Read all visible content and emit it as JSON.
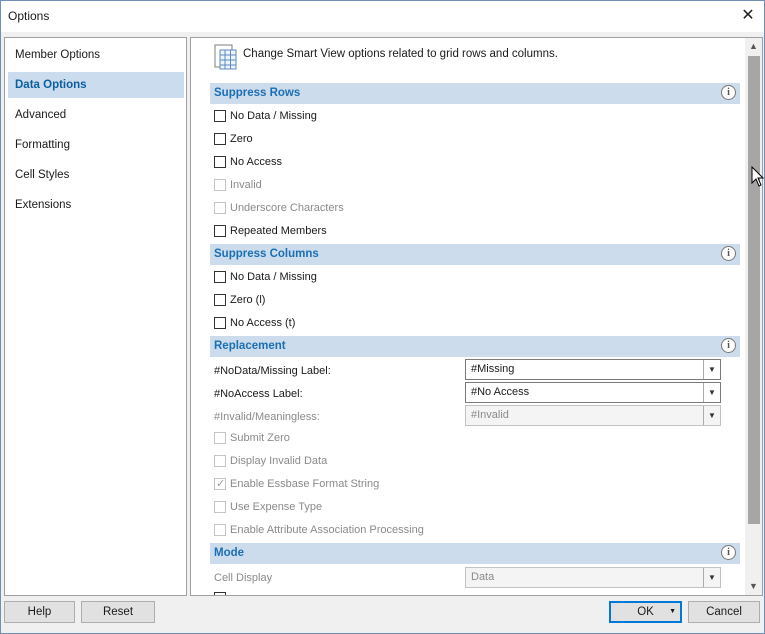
{
  "window": {
    "title": "Options"
  },
  "nav": {
    "items": [
      {
        "label": "Member Options"
      },
      {
        "label": "Data Options"
      },
      {
        "label": "Advanced"
      },
      {
        "label": "Formatting"
      },
      {
        "label": "Cell Styles"
      },
      {
        "label": "Extensions"
      }
    ],
    "selected": "Data Options"
  },
  "panel": {
    "header_text": "Change Smart View options related to grid rows and columns.",
    "suppress_rows": {
      "title": "Suppress Rows",
      "options": [
        {
          "label": "No Data / Missing",
          "checked": false,
          "enabled": true
        },
        {
          "label": "Zero",
          "checked": false,
          "enabled": true
        },
        {
          "label": "No Access",
          "checked": false,
          "enabled": true
        },
        {
          "label": "Invalid",
          "checked": false,
          "enabled": false
        },
        {
          "label": "Underscore Characters",
          "checked": false,
          "enabled": false
        },
        {
          "label": "Repeated Members",
          "checked": false,
          "enabled": true
        }
      ]
    },
    "suppress_columns": {
      "title": "Suppress Columns",
      "options": [
        {
          "label": "No Data / Missing",
          "checked": false,
          "enabled": true
        },
        {
          "label": "Zero (l)",
          "checked": false,
          "enabled": true
        },
        {
          "label": "No Access (t)",
          "checked": false,
          "enabled": true
        }
      ]
    },
    "replacement": {
      "title": "Replacement",
      "fields": [
        {
          "label": "#NoData/Missing Label:",
          "value": "#Missing",
          "enabled": true
        },
        {
          "label": "#NoAccess Label:",
          "value": "#No Access",
          "enabled": true
        },
        {
          "label": "#Invalid/Meaningless:",
          "value": "#Invalid",
          "enabled": false
        }
      ],
      "options": [
        {
          "label": "Submit Zero",
          "checked": false,
          "enabled": false
        },
        {
          "label": "Display Invalid Data",
          "checked": false,
          "enabled": false
        },
        {
          "label": "Enable Essbase Format String",
          "checked": true,
          "enabled": false
        },
        {
          "label": "Use Expense Type",
          "checked": false,
          "enabled": false
        },
        {
          "label": "Enable Attribute Association Processing",
          "checked": false,
          "enabled": false
        }
      ]
    },
    "mode": {
      "title": "Mode",
      "cell_display_label": "Cell Display",
      "cell_display_value": "Data"
    }
  },
  "buttons": {
    "help": "Help",
    "reset": "Reset",
    "ok": "OK",
    "cancel": "Cancel"
  },
  "glyphs": {
    "close": "✕",
    "info": "i",
    "arrow_down": "▼",
    "arrow_up": "▲",
    "check": "✓"
  },
  "colors": {
    "section_band": "#cddcec",
    "section_title": "#1a6fb4",
    "nav_selected_bg": "#cbdcee",
    "nav_selected_text": "#0b5f9e",
    "ok_border": "#0078d7"
  }
}
